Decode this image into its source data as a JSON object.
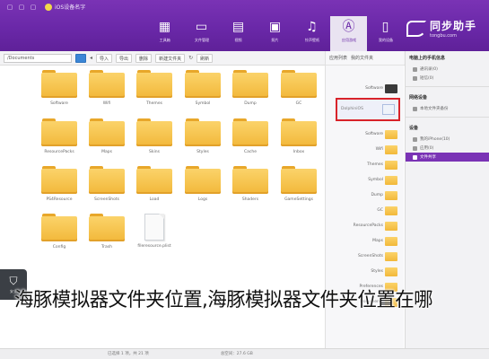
{
  "titlebar": {
    "title": "iOS设备名字",
    "controls": [
      "▢",
      "▢",
      "▢"
    ]
  },
  "nav": {
    "items": [
      {
        "label": "我的设备",
        "icon": "phone-icon"
      },
      {
        "label": "应用游戏",
        "icon": "appstore-icon",
        "active": true
      },
      {
        "label": "铃声壁纸",
        "icon": "music-icon"
      },
      {
        "label": "照片",
        "icon": "picture-icon"
      },
      {
        "label": "视频",
        "icon": "film-icon"
      },
      {
        "label": "文件管理",
        "icon": "folder-icon"
      },
      {
        "label": "工具箱",
        "icon": "grid-icon"
      }
    ]
  },
  "logo": {
    "cn": "同步助手",
    "en": "tongbu.com"
  },
  "toolbar": {
    "address": "/Documents",
    "buttons": [
      "导入",
      "导出",
      "删除",
      "新建文件夹"
    ],
    "refresh": "刷新"
  },
  "files": [
    {
      "name": "Software",
      "type": "folder"
    },
    {
      "name": "Wifi",
      "type": "folder"
    },
    {
      "name": "Themes",
      "type": "folder"
    },
    {
      "name": "Symbol",
      "type": "folder"
    },
    {
      "name": "Dump",
      "type": "folder"
    },
    {
      "name": "GC",
      "type": "folder"
    },
    {
      "name": "ResourcePacks",
      "type": "folder"
    },
    {
      "name": "Maps",
      "type": "folder"
    },
    {
      "name": "Skins",
      "type": "folder"
    },
    {
      "name": "Styles",
      "type": "folder"
    },
    {
      "name": "Cache",
      "type": "folder"
    },
    {
      "name": "Inbox",
      "type": "folder"
    },
    {
      "name": "PS4Resource",
      "type": "folder"
    },
    {
      "name": "ScreenShots",
      "type": "folder"
    },
    {
      "name": "Load",
      "type": "folder"
    },
    {
      "name": "Logs",
      "type": "folder"
    },
    {
      "name": "Shaders",
      "type": "folder"
    },
    {
      "name": "GameSettings",
      "type": "folder"
    },
    {
      "name": "Config",
      "type": "folder"
    },
    {
      "name": "Trash",
      "type": "folder"
    },
    {
      "name": "fileresource.plist",
      "type": "doc"
    }
  ],
  "midlist": {
    "header": [
      "应用列表",
      "我的文件夹"
    ],
    "items": [
      "Software",
      "Chrome",
      "Dolphin iOS",
      "Software",
      "Wifi",
      "Themes",
      "Symbol",
      "Dump",
      "GC",
      "ResourcePacks",
      "Maps",
      "ScreenShots",
      "Styles",
      "Preferences",
      "Documents"
    ],
    "selected_label": "DolphiniOS"
  },
  "rpanel": {
    "sections": [
      {
        "title": "电脑上的手机信息",
        "items": [
          "通讯录(0)",
          "短信(0)"
        ]
      },
      {
        "title": "网络设备",
        "items": [
          "本地文件夹备份"
        ]
      },
      {
        "title": "设备",
        "items": [
          "我的iPhone(10)",
          "应用(0)",
          "文件共享"
        ]
      }
    ],
    "active_item": "文件共享"
  },
  "status": {
    "left": "已选择 1 项，共 21 项",
    "right": "总空间：27.6 GB"
  },
  "shield": {
    "label": "安全"
  },
  "caption": "海豚模拟器文件夹位置,海豚模拟器文件夹位置在哪"
}
